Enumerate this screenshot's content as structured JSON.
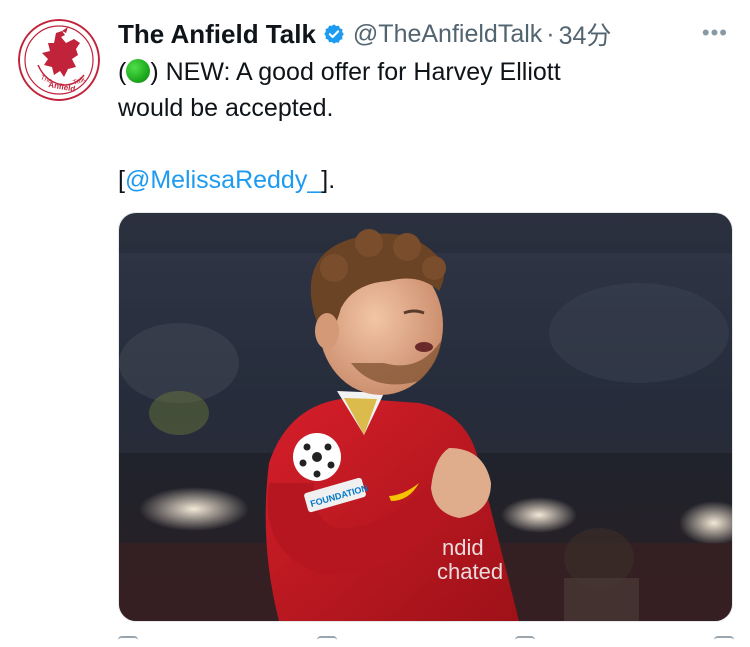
{
  "tweet": {
    "author_name": "The Anfield Talk",
    "handle": "@TheAnfieldTalk",
    "separator": "·",
    "time": "34分",
    "more": "•••",
    "text_line1_open": "(",
    "text_line1_rest": ") NEW: A good offer for Harvey Elliott",
    "text_line2": "would be accepted.",
    "mention_open": "[",
    "mention": "@MelissaReddy_",
    "mention_close": "]."
  },
  "avatar": {
    "logo_text": "The Anfield Talk"
  },
  "media": {
    "shirt_sponsor": "ndid\nchated",
    "badge_text": "FOUNDATION"
  },
  "colors": {
    "accent": "#1d9bf0",
    "brand_red": "#c8102e"
  },
  "icons": [
    "verified-badge-icon",
    "more-icon",
    "green-circle-emoji",
    "reply-icon",
    "retweet-icon",
    "like-icon",
    "share-icon"
  ]
}
